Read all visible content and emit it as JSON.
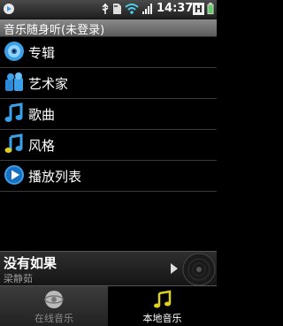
{
  "status_bar": {
    "time": "14:37",
    "icons": [
      "play-status-icon",
      "usb-icon",
      "sd-card-icon",
      "wifi-icon",
      "signal-icon",
      "battery-icon"
    ]
  },
  "title_bar": {
    "title": "音乐随身听(未登录)"
  },
  "menu": {
    "items": [
      {
        "label": "专辑",
        "icon": "album-icon"
      },
      {
        "label": "艺术家",
        "icon": "artist-icon"
      },
      {
        "label": "歌曲",
        "icon": "song-note-icon"
      },
      {
        "label": "风格",
        "icon": "genre-note-icon"
      },
      {
        "label": "播放列表",
        "icon": "playlist-icon"
      }
    ]
  },
  "now_playing": {
    "song": "没有如果",
    "artist": "梁静茹"
  },
  "tabs": [
    {
      "label": "在线音乐",
      "icon": "online-music-icon",
      "selected": false
    },
    {
      "label": "本地音乐",
      "icon": "local-music-icon",
      "selected": true
    }
  ],
  "colors": {
    "background": "#000000",
    "title_bar": "#6e6e6e",
    "note_accent": "#e0d020",
    "icon_blue": "#3aa0e8"
  }
}
